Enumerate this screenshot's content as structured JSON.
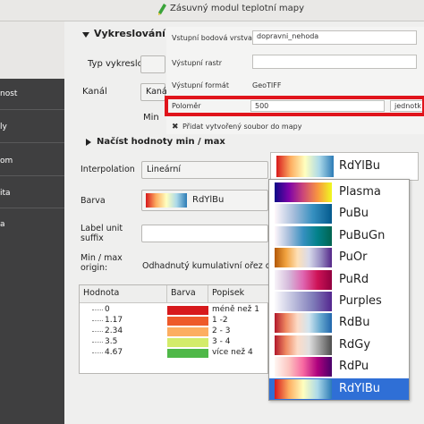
{
  "window": {
    "title": "Zásuvný modul teplotní mapy",
    "app_icon": "pencil-icon"
  },
  "sidebar": {
    "top_label": "",
    "items": [
      {
        "label": "nost"
      },
      {
        "label": "ly"
      },
      {
        "label": "om"
      },
      {
        "label": "ita"
      },
      {
        "label": "a"
      }
    ]
  },
  "section_render": {
    "title": "Vykreslování p",
    "type_label": "Typ vykreslování",
    "type_value": "",
    "channel_label": "Kanál",
    "channel_value": "Kaná",
    "min_label": "Min"
  },
  "settings": {
    "input_layer_label": "Vstupní bodová vrstva",
    "input_layer_value": "dopravni_nehoda",
    "output_raster_label": "Výstupní rastr",
    "output_raster_value": "",
    "output_format_label": "Výstupní formát",
    "output_format_value": "GeoTIFF",
    "radius_label": "Poloměr",
    "radius_value": "500",
    "radius_unit": "jednotk",
    "add_file_label": "Přidat vytvořený soubor do mapy"
  },
  "section_minmax": {
    "title": "Načíst hodnoty min / max"
  },
  "form": {
    "interpolation_label": "Interpolation",
    "interpolation_value": "Lineární",
    "color_label": "Barva",
    "color_value": "RdYlBu",
    "unit_suffix_label": "Label unit suffix",
    "minmax_origin_label": "Min / max origin:",
    "minmax_origin_value": "Odhadnutý kumulativní ořez of"
  },
  "table": {
    "headers": [
      "Hodnota",
      "Barva",
      "Popisek"
    ],
    "rows": [
      {
        "value": "0",
        "color": "#d7191c",
        "label": "méně než 1"
      },
      {
        "value": "1.17",
        "color": "#ee5a2a",
        "label": "1 -2"
      },
      {
        "value": "2.34",
        "color": "#fdae61",
        "label": "2 - 3"
      },
      {
        "value": "3.5",
        "color": "#d3ec6a",
        "label": "3 - 4"
      },
      {
        "value": "4.67",
        "color": "#4fb848",
        "label": "více než 4"
      }
    ]
  },
  "ramp_dropdown": {
    "current": "RdYlBu",
    "options": [
      {
        "name": "Plasma",
        "gradient": "linear-gradient(90deg,#0d0887,#7e03a8,#cc4778,#f89540,#f0f921)",
        "selected": false
      },
      {
        "name": "PuBu",
        "gradient": "linear-gradient(90deg,#fff7fb,#a6bddb,#3690c0,#045a8d)",
        "selected": false
      },
      {
        "name": "PuBuGn",
        "gradient": "linear-gradient(90deg,#fff7fb,#a6bddb,#3690c0,#02818a,#016450)",
        "selected": false
      },
      {
        "name": "PuOr",
        "gradient": "linear-gradient(90deg,#b35806,#f1a340,#fee0b6,#d8daeb,#998ec3,#542788)",
        "selected": false
      },
      {
        "name": "PuRd",
        "gradient": "linear-gradient(90deg,#f7f4f9,#d4b9da,#df65b0,#ce1256,#91003f)",
        "selected": false
      },
      {
        "name": "Purples",
        "gradient": "linear-gradient(90deg,#fcfbfd,#bcbddc,#807dba,#54278f)",
        "selected": false
      },
      {
        "name": "RdBu",
        "gradient": "linear-gradient(90deg,#b2182b,#ef8a62,#fddbc7,#d1e5f0,#67a9cf,#2166ac)",
        "selected": false
      },
      {
        "name": "RdGy",
        "gradient": "linear-gradient(90deg,#b2182b,#ef8a62,#fddbc7,#e0e0e0,#999999,#4d4d4d)",
        "selected": false
      },
      {
        "name": "RdPu",
        "gradient": "linear-gradient(90deg,#fff7f3,#fcc5c0,#f768a1,#ae017e,#49006a)",
        "selected": false
      },
      {
        "name": "RdYlBu",
        "gradient": "linear-gradient(90deg,#d7191c,#fdae61,#ffffbf,#abd9e9,#2c7bb6)",
        "selected": true
      }
    ]
  },
  "colors": {
    "highlight_border": "#e0141b",
    "selection": "#2f6fd6",
    "sidebar_bg": "#3f3f40"
  }
}
